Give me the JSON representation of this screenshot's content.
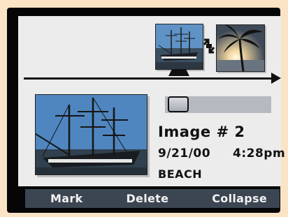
{
  "photo": {
    "title": "Image # 2",
    "date": "9/21/00",
    "time": "4:28pm",
    "caption": "BEACH"
  },
  "thumbnails": [
    {
      "icon": "tall-ship-photo-icon"
    },
    {
      "icon": "palm-tree-sunset-photo-icon"
    }
  ],
  "menu": {
    "mark": "Mark",
    "delete": "Delete",
    "collapse": "Collapse"
  },
  "colors": {
    "screen_bg": "#ececec",
    "menu_bar": "#3c4552",
    "slider_track": "#b6bac0",
    "bezel": "#060606"
  }
}
